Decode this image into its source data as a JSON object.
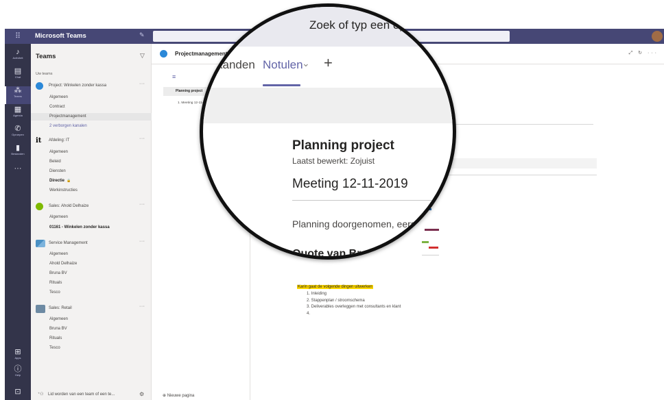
{
  "titlebar": {
    "app_name": "Microsoft Teams",
    "waffle_icon": "app-launcher-icon",
    "compose_icon": "compose-icon",
    "search_placeholder": "Zoek of typ een opdracht",
    "bar_color": "#464775"
  },
  "rail": {
    "items": [
      {
        "label": "Activiteit",
        "icon": "bell-icon",
        "glyph": "🔔"
      },
      {
        "label": "Chat",
        "icon": "chat-icon",
        "glyph": "▤"
      },
      {
        "label": "Teams",
        "icon": "teams-icon",
        "glyph": "⁂"
      },
      {
        "label": "Agenda",
        "icon": "calendar-icon",
        "glyph": "▦"
      },
      {
        "label": "Oproepen",
        "icon": "phone-icon",
        "glyph": "✆"
      },
      {
        "label": "Bestanden",
        "icon": "files-icon",
        "glyph": "▮"
      },
      {
        "label": "",
        "icon": "more-icon",
        "glyph": "···"
      }
    ],
    "bottom": [
      {
        "label": "Apps",
        "icon": "apps-icon",
        "glyph": "⊞"
      },
      {
        "label": "Help",
        "icon": "help-icon",
        "glyph": "ⓘ"
      },
      {
        "label": "",
        "icon": "feedback-icon",
        "glyph": "⊡"
      }
    ]
  },
  "teams_panel": {
    "title": "Teams",
    "section_label": "Uw teams",
    "teams": [
      {
        "name": "Project: Winkelen zonder kassa",
        "logo_color": "#2b88d8",
        "channels": [
          "Algemeen",
          "Contract",
          "Projectmanagement",
          "2 verborgen kanalen"
        ]
      },
      {
        "name": "Afdeling: IT",
        "logo_color": "#ffffff",
        "channels": [
          "Algemeen",
          "Beleid",
          "Diensten",
          "Directie",
          "Werkinstructies"
        ]
      },
      {
        "name": "Sales: Ahold Delhaize",
        "logo_color": "#7fba00",
        "channels": [
          "Algemeen",
          "01161 - Winkelen zonder kassa"
        ]
      },
      {
        "name": "Service Management",
        "logo_color": "#4a90c4",
        "channels": [
          "Algemeen",
          "Ahold Delhaize",
          "Bruna BV",
          "Rituals",
          "Tesco"
        ]
      },
      {
        "name": "Sales: Retail",
        "logo_color": "#6d8aa3",
        "channels": [
          "Algemeen",
          "Bruna BV",
          "Rituals",
          "Tesco"
        ]
      }
    ],
    "it_logo_text": "it",
    "join_label": "Lid worden van een team of een te..."
  },
  "main": {
    "channel_title": "Projectmanagement",
    "pages": {
      "section": "Planning project",
      "page": "1. Meeting 12-11-2019",
      "new_page": "Nieuwe pagina"
    },
    "note": {
      "highlight": "Karin gaat de volgende dingen uitwerken",
      "list": [
        "1. Inleiding",
        "2. Stappenplan / stroomschema",
        "3. Deliverables overleggen met consultants en klant",
        "4."
      ]
    }
  },
  "magnifier": {
    "search": "Zoek of typ een opdracht",
    "tab_partial": "kanden",
    "tab_active": "Notulen",
    "notebook_title": "Planning project",
    "last_edited": "Laatst bewerkt: Zojuist",
    "meeting_title": "Meeting 12-11-2019",
    "body_text": "Planning doorgenomen, eerst",
    "quote": "Quote van Bram M",
    "accent": "#6264a7"
  }
}
